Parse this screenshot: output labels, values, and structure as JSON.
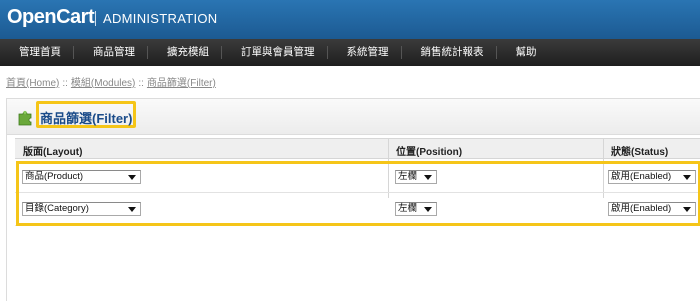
{
  "header": {
    "logo": "OpenCart",
    "subtitle": "ADMINISTRATION"
  },
  "menu": {
    "items": [
      {
        "label": "管理首頁"
      },
      {
        "label": "商品管理"
      },
      {
        "label": "擴充模組"
      },
      {
        "label": "訂單與會員管理"
      },
      {
        "label": "系統管理"
      },
      {
        "label": "銷售統計報表"
      },
      {
        "label": "幫助"
      }
    ]
  },
  "breadcrumb": {
    "items": [
      {
        "label": "首頁(Home)"
      },
      {
        "label": "模組(Modules)"
      },
      {
        "label": "商品篩選(Filter)"
      }
    ],
    "separator": "::"
  },
  "box": {
    "title": "商品篩選(Filter)",
    "icon": "puzzle-icon"
  },
  "table": {
    "headers": {
      "layout": "版面(Layout)",
      "position": "位置(Position)",
      "status": "狀態(Status)"
    },
    "rows": [
      {
        "layout": "商品(Product)",
        "position": "左欄",
        "status": "啟用(Enabled)"
      },
      {
        "layout": "目錄(Category)",
        "position": "左欄",
        "status": "啟用(Enabled)"
      }
    ]
  },
  "colors": {
    "header_blue": "#1c5a92",
    "menu_dark": "#1e1e1e",
    "title_blue": "#1b4c8a",
    "highlight": "#f5c518"
  }
}
